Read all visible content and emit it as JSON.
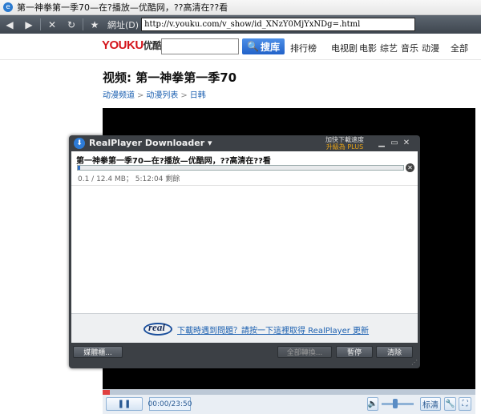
{
  "browser": {
    "title": "第一神拳第一季70—在?播放—优酷网，??高清在??看",
    "address_label": "網址(D)",
    "url": "http://v.youku.com/v_show/id_XNzY0MjYxNDg=.html"
  },
  "site": {
    "logo_main": "YOUKU",
    "logo_cn": "优酷",
    "search_placeholder": "",
    "search_button": "搜库",
    "nav": [
      "排行榜",
      "电视剧",
      "电影",
      "综艺",
      "音乐",
      "动漫",
      "全部"
    ],
    "page_title": "视频: 第一神拳第一季70",
    "breadcrumbs": [
      "动漫频道",
      "动漫列表",
      "日韩"
    ],
    "breadcrumb_sep": ">"
  },
  "player": {
    "time": "00:00/23:50",
    "quality_button": "标清",
    "seek_progress": 0.02,
    "volume_level": 0.4
  },
  "downloader": {
    "app_title": "RealPlayer Downloader",
    "speed_line1": "加快下載速度",
    "speed_line2": "升級為",
    "speed_line2b": "PLUS",
    "file_name": "第一神拳第一季70—在?播放—优酷网，??高清在??看",
    "progress": 0.008,
    "status": "0.1 / 12.4 MB；  5:12:04 剩餘",
    "promo_logo": "real",
    "promo_link": "下載時遇到問題？請按一下這裡取得 RealPlayer 更新",
    "buttons": {
      "library": "媒體櫃...",
      "convert_all": "全部轉換...",
      "pause": "暫停",
      "clear": "清除"
    }
  },
  "colors": {
    "accent_blue": "#2262c9",
    "logo_red": "#d4141b",
    "downloader_frame": "#3c4045",
    "progress_fill": "#2f6fc7"
  }
}
